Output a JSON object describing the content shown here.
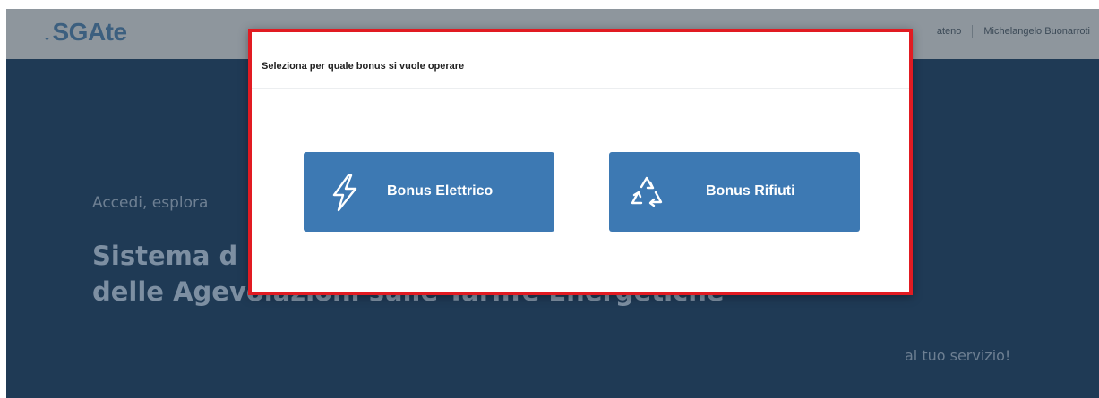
{
  "header": {
    "logo": "SGAte",
    "logo_mark": "↓",
    "nav_item": "ateno",
    "user_name": "Michelangelo Buonarroti"
  },
  "hero": {
    "subtitle": "Accedi, esplora",
    "title_line1": "Sistema d",
    "title_line2": "delle Agevolazioni sulle Tariffe Energetiche",
    "tagline": "al tuo servizio!"
  },
  "modal": {
    "title": "Seleziona per quale bonus si vuole operare",
    "buttons": [
      {
        "label": "Bonus Elettrico",
        "icon": "lightning-icon"
      },
      {
        "label": "Bonus Rifiuti",
        "icon": "recycle-icon"
      }
    ]
  },
  "colors": {
    "modal_border": "#e11b22",
    "button_bg": "#3d79b3",
    "hero_bg": "#1f3a55"
  }
}
